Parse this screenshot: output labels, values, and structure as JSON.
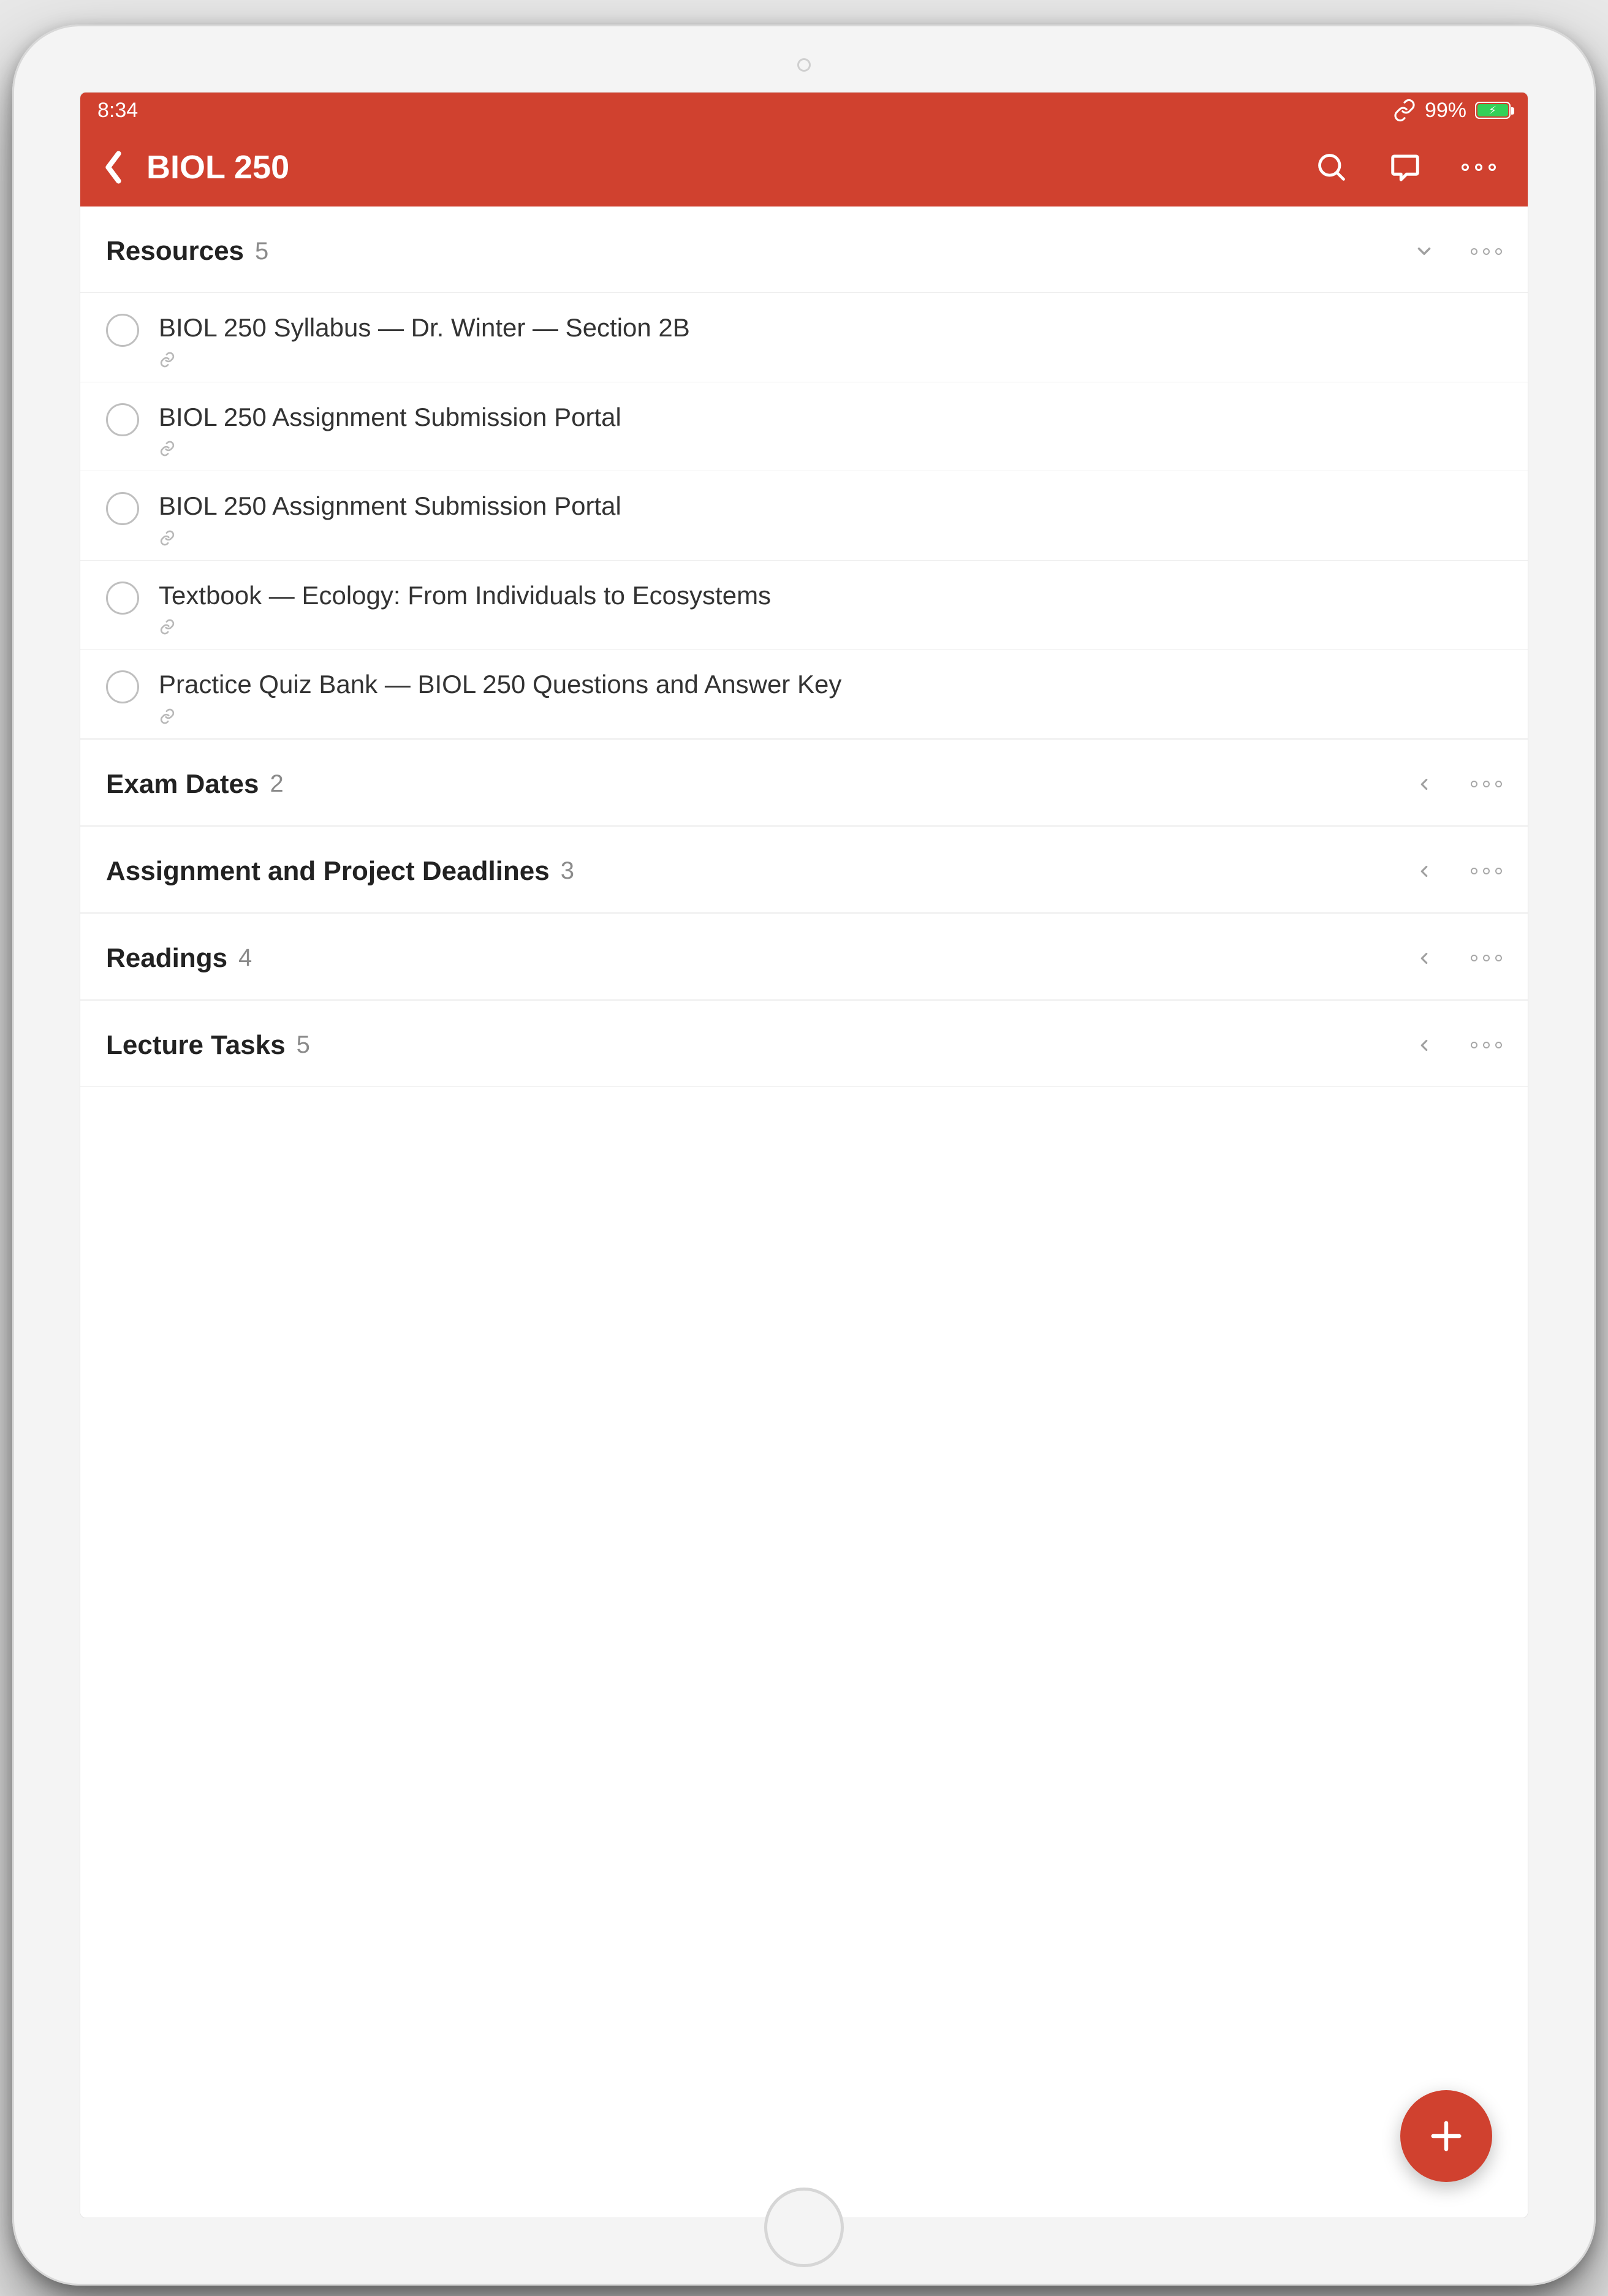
{
  "status": {
    "time": "8:34",
    "battery_percent": "99%",
    "battery_fill_pct": 99
  },
  "nav": {
    "title": "BIOL 250"
  },
  "colors": {
    "accent": "#d0412f"
  },
  "sections": [
    {
      "title": "Resources",
      "count": "5",
      "expanded": true,
      "tasks": [
        {
          "title": "BIOL 250 Syllabus — Dr. Winter — Section 2B",
          "has_link": true
        },
        {
          "title": "BIOL 250 Assignment Submission Portal",
          "has_link": true
        },
        {
          "title": "BIOL 250 Assignment Submission Portal",
          "has_link": true
        },
        {
          "title": "Textbook — Ecology: From Individuals to Ecosystems",
          "has_link": true
        },
        {
          "title": "Practice Quiz Bank — BIOL 250 Questions and Answer Key",
          "has_link": true
        }
      ]
    },
    {
      "title": "Exam Dates",
      "count": "2",
      "expanded": false,
      "tasks": []
    },
    {
      "title": "Assignment and Project Deadlines",
      "count": "3",
      "expanded": false,
      "tasks": []
    },
    {
      "title": "Readings",
      "count": "4",
      "expanded": false,
      "tasks": []
    },
    {
      "title": "Lecture Tasks",
      "count": "5",
      "expanded": false,
      "tasks": []
    }
  ]
}
